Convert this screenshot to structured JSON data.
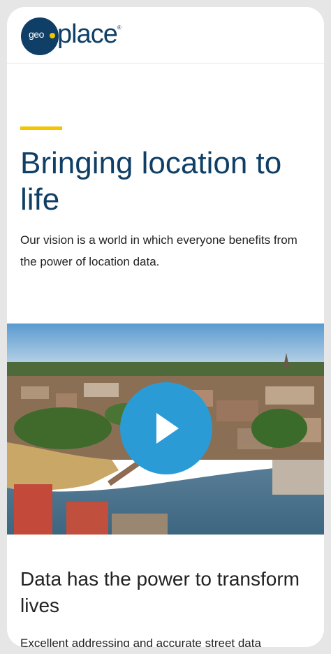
{
  "header": {
    "logo": {
      "prefix": "geo",
      "word": "place",
      "registered": "®"
    }
  },
  "hero": {
    "title": "Bringing location to life",
    "text": "Our vision is a world in which everyone benefits from the power of location data."
  },
  "video": {
    "play_icon": "play-icon",
    "play_color": "#2b9bd6"
  },
  "section": {
    "title": "Data has the power to transform lives",
    "text": "Excellent addressing and accurate street data"
  },
  "colors": {
    "brand_navy": "#0f3f66",
    "accent_yellow": "#f5c400",
    "play_blue": "#2b9bd6"
  }
}
